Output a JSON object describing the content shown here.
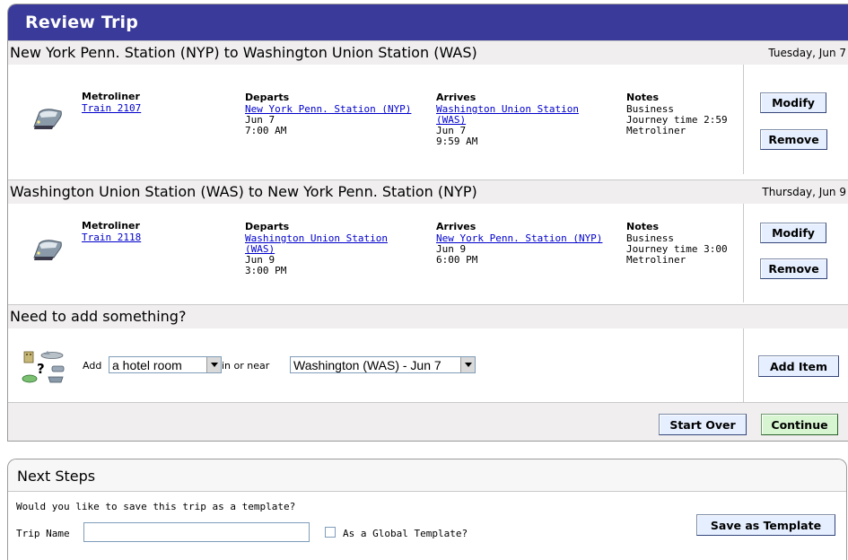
{
  "review": {
    "title": "Review Trip",
    "segments": [
      {
        "route": "New York Penn. Station (NYP) to Washington Union Station (WAS)",
        "date": "Tuesday, Jun 7",
        "carrier": "Metroliner",
        "train": "Train 2107",
        "departs_label": "Departs",
        "departs_station": "New York Penn. Station (NYP)",
        "departs_date": "Jun 7",
        "departs_time": "7:00 AM",
        "arrives_label": "Arrives",
        "arrives_station_line1": "Washington Union Station",
        "arrives_station_line2": "(WAS)",
        "arrives_date": "Jun 7",
        "arrives_time": "9:59 AM",
        "notes_label": "Notes",
        "notes_class": "Business",
        "notes_journey": "Journey time 2:59",
        "notes_type": "Metroliner",
        "modify_label": "Modify",
        "remove_label": "Remove"
      },
      {
        "route": "Washington Union Station (WAS) to New York Penn. Station (NYP)",
        "date": "Thursday, Jun 9",
        "carrier": "Metroliner",
        "train": "Train 2118",
        "departs_label": "Departs",
        "departs_station_line1": "Washington Union Station",
        "departs_station_line2": "(WAS)",
        "departs_date": "Jun 9",
        "departs_time": "3:00 PM",
        "arrives_label": "Arrives",
        "arrives_station": "New York Penn. Station (NYP)",
        "arrives_date": "Jun 9",
        "arrives_time": "6:00 PM",
        "notes_label": "Notes",
        "notes_class": "Business",
        "notes_journey": "Journey time 3:00",
        "notes_type": "Metroliner",
        "modify_label": "Modify",
        "remove_label": "Remove"
      }
    ],
    "add": {
      "heading": "Need to add something?",
      "add_text": "Add",
      "item_selected": "a hotel room",
      "near_text": "in or near",
      "location_selected": "Washington (WAS) - Jun 7",
      "add_button": "Add Item"
    },
    "start_over_label": "Start Over",
    "continue_label": "Continue"
  },
  "next_steps": {
    "title": "Next Steps",
    "question": "Would you like to save this trip as a template?",
    "trip_name_label": "Trip Name",
    "trip_name_value": "",
    "global_label": "As a Global Template?",
    "save_button": "Save as Template"
  },
  "icons": {
    "train": "train-icon",
    "add_travel": "travel-options-icon"
  },
  "colors": {
    "title_bar": "#3a3a9a",
    "link": "#0000cc",
    "button": "#e6efff",
    "continue_button": "#d6f5d0"
  }
}
